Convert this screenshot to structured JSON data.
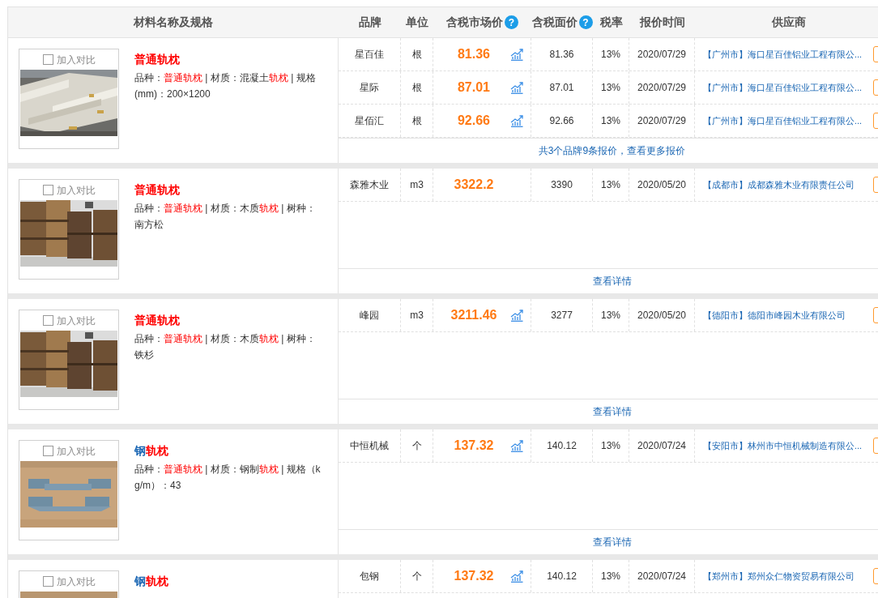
{
  "columns": [
    {
      "label": "材料名称及规格"
    },
    {
      "label": "品牌"
    },
    {
      "label": "单位"
    },
    {
      "label": "含税市场价",
      "help": "?"
    },
    {
      "label": "含税面价",
      "help": "?"
    },
    {
      "label": "税率"
    },
    {
      "label": "报价时间"
    },
    {
      "label": "供应商"
    }
  ],
  "groups": [
    {
      "compare": {
        "label": "加入对比",
        "checked": false
      },
      "title": [
        {
          "text": "普通轨枕",
          "highlight": true
        }
      ],
      "spec": [
        {
          "text": "品种：",
          "highlight": false
        },
        {
          "text": "普通轨枕",
          "highlight": true
        },
        {
          "text": " | 材质：混凝土",
          "highlight": false
        },
        {
          "text": "轨枕",
          "highlight": true
        },
        {
          "text": " | 规格(mm)：200×1200",
          "highlight": false
        }
      ],
      "quotes": [
        {
          "brand": "星百佳",
          "unit": "根",
          "price": "81.36",
          "trend": true,
          "face_price": "81.36",
          "tax": "13%",
          "date": "2020/07/29",
          "supplier": "【广州市】海口星百佳铝业工程有限公..."
        },
        {
          "brand": "星际",
          "unit": "根",
          "price": "87.01",
          "trend": true,
          "face_price": "87.01",
          "tax": "13%",
          "date": "2020/07/29",
          "supplier": "【广州市】海口星百佳铝业工程有限公..."
        },
        {
          "brand": "星佰汇",
          "unit": "根",
          "price": "92.66",
          "trend": true,
          "face_price": "92.66",
          "tax": "13%",
          "date": "2020/07/29",
          "supplier": "【广州市】海口星百佳铝业工程有限公..."
        }
      ],
      "footer": "共3个品牌9条报价，查看更多报价"
    },
    {
      "compare": {
        "label": "加入对比",
        "checked": false
      },
      "title": [
        {
          "text": "普通轨枕",
          "highlight": true
        }
      ],
      "spec": [
        {
          "text": "品种：",
          "highlight": false
        },
        {
          "text": "普通轨枕",
          "highlight": true
        },
        {
          "text": " | 材质：木质",
          "highlight": false
        },
        {
          "text": "轨枕",
          "highlight": true
        },
        {
          "text": " | 树种：南方松",
          "highlight": false
        }
      ],
      "quotes": [
        {
          "brand": "森雅木业",
          "unit": "m3",
          "price": "3322.2",
          "trend": false,
          "face_price": "3390",
          "tax": "13%",
          "date": "2020/05/20",
          "supplier": "【成都市】成都森雅木业有限责任公司"
        }
      ],
      "footer": "查看详情"
    },
    {
      "compare": {
        "label": "加入对比",
        "checked": false
      },
      "title": [
        {
          "text": "普通轨枕",
          "highlight": true
        }
      ],
      "spec": [
        {
          "text": "品种：",
          "highlight": false
        },
        {
          "text": "普通轨枕",
          "highlight": true
        },
        {
          "text": " | 材质：木质",
          "highlight": false
        },
        {
          "text": "轨枕",
          "highlight": true
        },
        {
          "text": " | 树种：铁杉",
          "highlight": false
        }
      ],
      "quotes": [
        {
          "brand": "峰园",
          "unit": "m3",
          "price": "3211.46",
          "trend": true,
          "face_price": "3277",
          "tax": "13%",
          "date": "2020/05/20",
          "supplier": "【德阳市】德阳市峰园木业有限公司"
        }
      ],
      "footer": "查看详情"
    },
    {
      "compare": {
        "label": "加入对比",
        "checked": false
      },
      "title": [
        {
          "text": "钢",
          "highlight": false
        },
        {
          "text": "轨枕",
          "highlight": true
        }
      ],
      "spec": [
        {
          "text": "品种：",
          "highlight": false
        },
        {
          "text": "普通轨枕",
          "highlight": true
        },
        {
          "text": " | 材质：钢制",
          "highlight": false
        },
        {
          "text": "轨枕",
          "highlight": true
        },
        {
          "text": " | 规格（kg/m）：43",
          "highlight": false
        }
      ],
      "quotes": [
        {
          "brand": "中恒机械",
          "unit": "个",
          "price": "137.32",
          "trend": true,
          "face_price": "140.12",
          "tax": "13%",
          "date": "2020/07/24",
          "supplier": "【安阳市】林州市中恒机械制造有限公..."
        }
      ],
      "footer": "查看详情"
    },
    {
      "compare": {
        "label": "加入对比",
        "checked": false
      },
      "title": [
        {
          "text": "钢",
          "highlight": false
        },
        {
          "text": "轨枕",
          "highlight": true
        }
      ],
      "quotes": [
        {
          "brand": "包钢",
          "unit": "个",
          "price": "137.32",
          "trend": true,
          "face_price": "140.12",
          "tax": "13%",
          "date": "2020/07/24",
          "supplier": "【郑州市】郑州众仁物资贸易有限公司"
        }
      ]
    }
  ]
}
